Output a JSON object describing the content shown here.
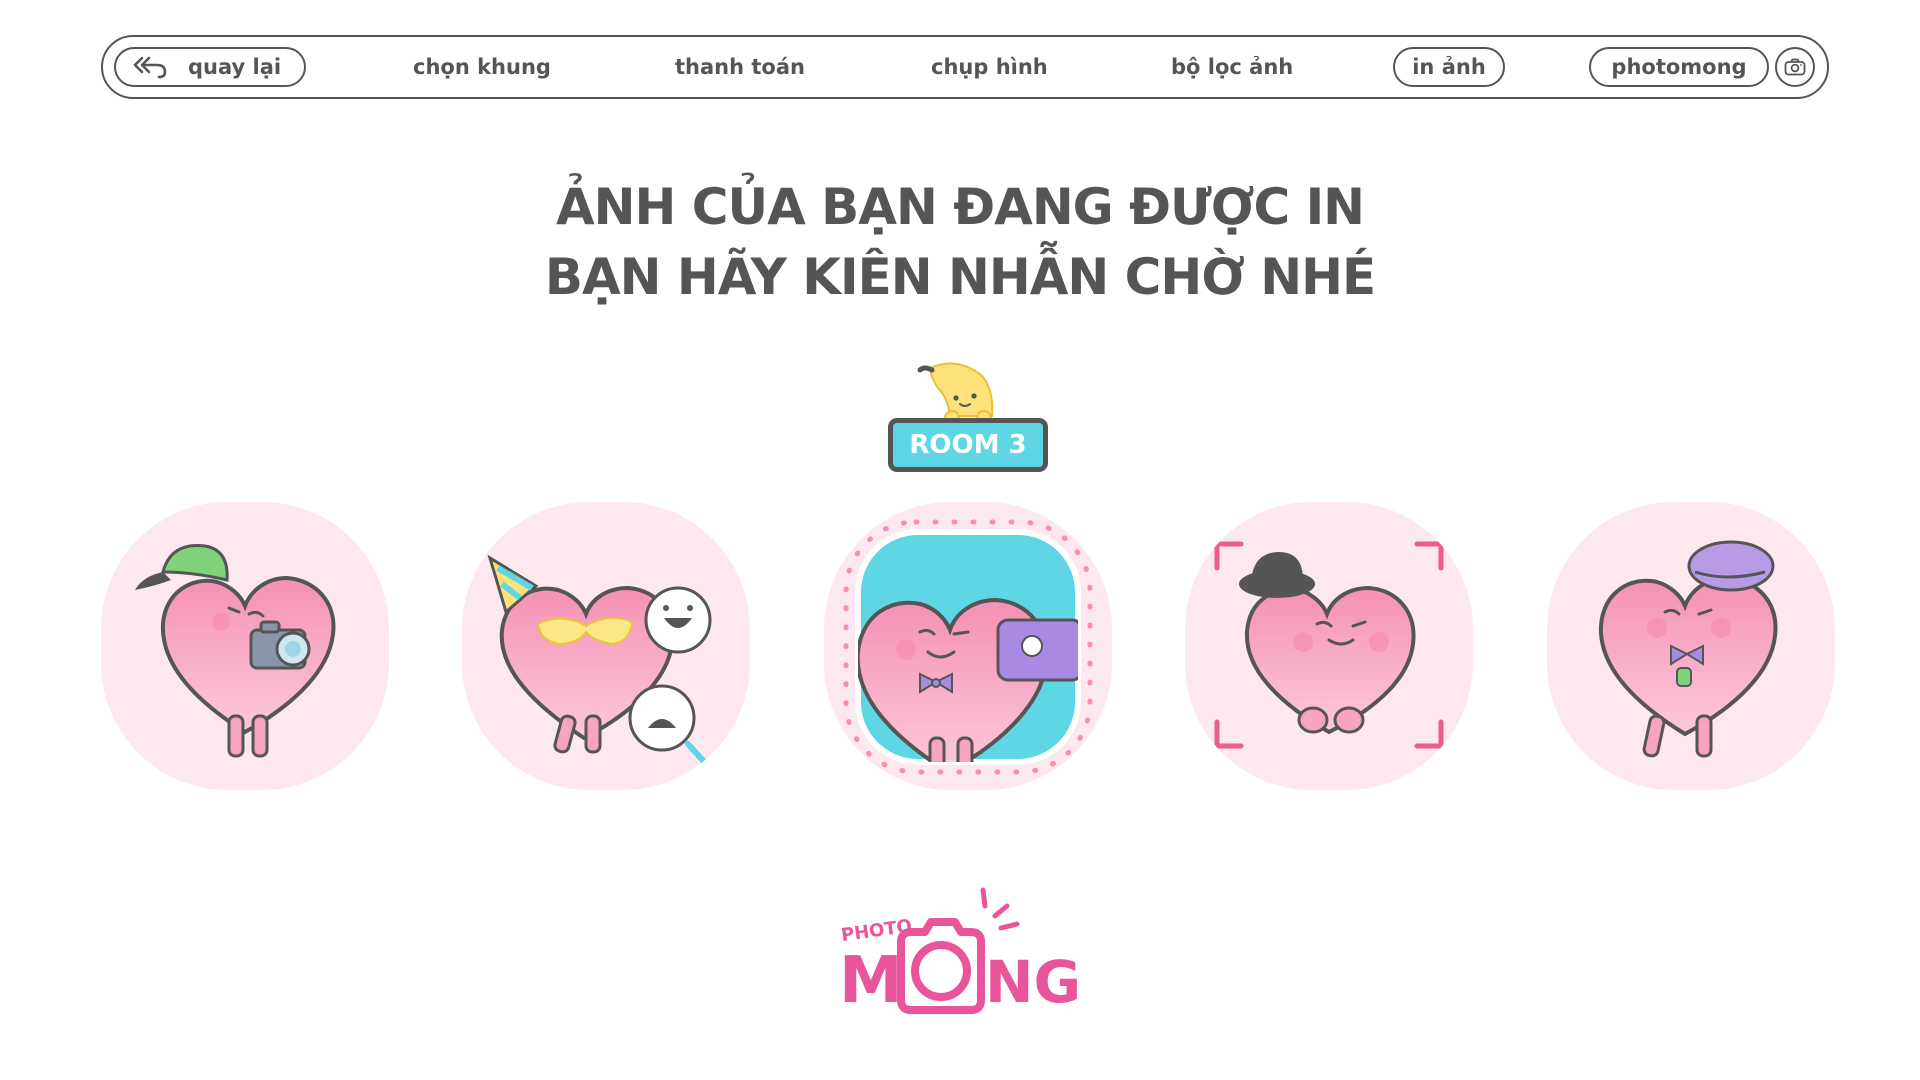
{
  "nav": {
    "back_label": "quay lại",
    "steps": [
      "chọn khung",
      "thanh toán",
      "chụp hình",
      "bộ lọc ảnh"
    ],
    "active_step": "in ảnh",
    "brand_label": "photomong",
    "back_icon": "back-arrow-icon",
    "camera_icon": "camera-icon"
  },
  "headline": {
    "line1": "ẢNH CỦA BẠN ĐANG ĐƯỢC IN",
    "line2": "BẠN HÃY KIÊN NHẪN CHỜ NHÉ"
  },
  "room": {
    "label": "ROOM 3"
  },
  "logo": {
    "small": "PHOTO",
    "big_left": "M",
    "big_right": "NG"
  },
  "colors": {
    "text": "#555555",
    "card_bg": "#fde8ef",
    "heart_pink": "#f58fb0",
    "accent_cyan": "#5fd6e4",
    "brand_pink": "#e8559a"
  }
}
